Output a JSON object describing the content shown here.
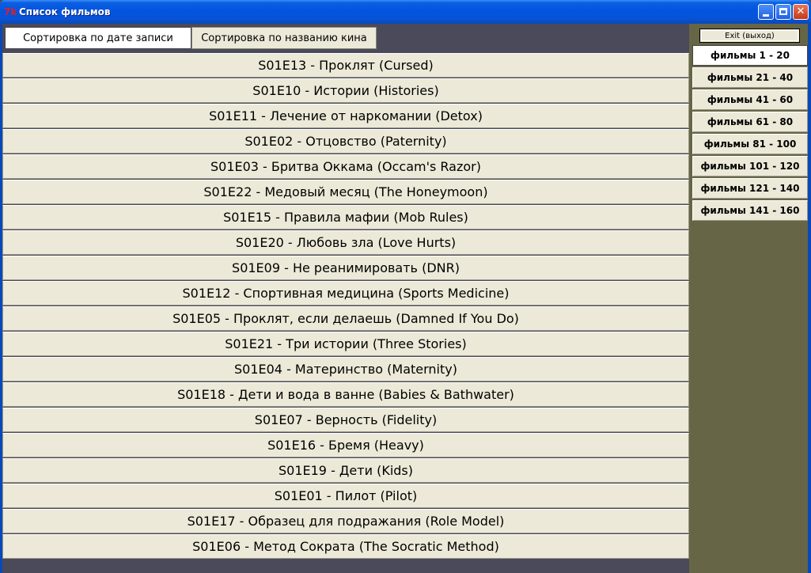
{
  "window": {
    "title": "Список фильмов",
    "icon": "app-red-logo-icon",
    "controls": [
      "minimize",
      "maximize",
      "close"
    ]
  },
  "colors": {
    "titlebar": "#0454e0",
    "main_bg": "#4a4a5a",
    "panel_bg": "#666646",
    "button_bg": "#ece9d8",
    "active_button_bg": "#ffffff"
  },
  "toolbar": {
    "sort_by_date_label": "Сортировка по дате записи",
    "sort_by_name_label": "Сортировка по названию кина"
  },
  "side_panel": {
    "exit_label": "Exit (выход)",
    "ranges": [
      {
        "label": "фильмы 1 - 20",
        "active": true
      },
      {
        "label": "фильмы 21 - 40",
        "active": false
      },
      {
        "label": "фильмы 41 - 60",
        "active": false
      },
      {
        "label": "фильмы 61 - 80",
        "active": false
      },
      {
        "label": "фильмы 81 - 100",
        "active": false
      },
      {
        "label": "фильмы 101 - 120",
        "active": false
      },
      {
        "label": "фильмы 121 - 140",
        "active": false
      },
      {
        "label": "фильмы 141 - 160",
        "active": false
      }
    ]
  },
  "films": [
    "S01E13 - Проклят (Cursed)",
    "S01E10 - Истории (Histories)",
    "S01E11 - Лечение от наркомании (Detox)",
    "S01E02 - Отцовство (Paternity)",
    "S01E03 - Бритва Оккама (Occam's Razor)",
    "S01E22 - Медовый месяц (The Honeymoon)",
    "S01E15 - Правила мафии (Mob Rules)",
    "S01E20 - Любовь зла (Love Hurts)",
    "S01E09 - Не реанимировать (DNR)",
    "S01E12 - Спортивная медицина (Sports Medicine)",
    "S01E05 - Проклят, если делаешь (Damned If You Do)",
    "S01E21 - Три истории (Three Stories)",
    "S01E04 - Материнство (Maternity)",
    "S01E18 - Дети и вода в ванне (Babies & Bathwater)",
    "S01E07 - Верность (Fidelity)",
    "S01E16 - Бремя (Heavy)",
    "S01E19 - Дети (Kids)",
    "S01E01 - Пилот (Pilot)",
    "S01E17 - Образец для подражания (Role Model)",
    "S01E06 - Метод Сократа (The Socratic Method)"
  ]
}
